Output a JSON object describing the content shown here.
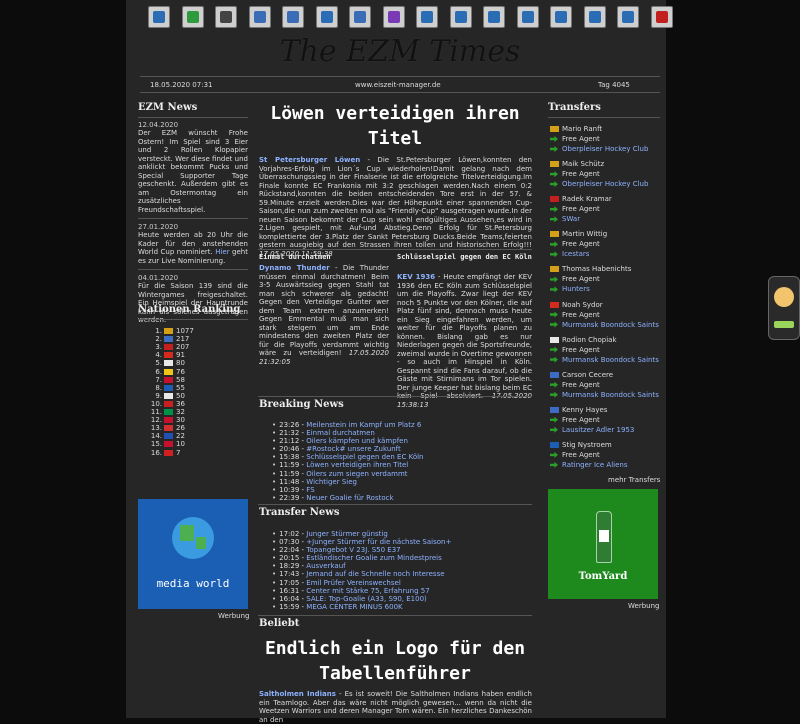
{
  "toolbar": {
    "icons": [
      "home-icon",
      "jersey-icon",
      "lineup-icon",
      "training-icon",
      "list-icon",
      "team-icon",
      "players-icon",
      "calendar-icon",
      "league-icon",
      "tactics-icon",
      "transfers-icon",
      "stats-icon",
      "mail-icon",
      "settings-icon",
      "chat-icon",
      "logout-icon"
    ]
  },
  "masthead": {
    "title": "The EZM Times"
  },
  "dateline": {
    "date": "18.05.2020 07:31",
    "site": "www.eiszeit-manager.de",
    "day": "Tag 4045"
  },
  "ezm_news": {
    "title": "EZM News",
    "items": [
      {
        "date": "12.04.2020",
        "text": "Der EZM wünscht Frohe Ostern! Im Spiel sind 3 Eier und 2 Rollen Klopapier versteckt. Wer diese findet und anklickt bekommt Pucks und Special Supporter Tage geschenkt. Außerdem gibt es am Ostermontag ein zusätzliches Freundschaftsspiel."
      },
      {
        "date": "27.01.2020",
        "text": "Heute werden ab 20 Uhr die Kader für den anstehenden World Cup nominiert.",
        "link": "Hier",
        "text2": " geht es zur Live Nominierung."
      },
      {
        "date": "04.01.2020",
        "text": "Für die Saison 139 sind die Wintergames freigeschaltet. Ein Heimspiel der Hauptrunde kann als solches ausgetragen werden."
      }
    ]
  },
  "rankings": {
    "title": "Nationen Ranking",
    "rows": [
      {
        "rank": "1.",
        "value": "1077",
        "color": "#d4a017"
      },
      {
        "rank": "2.",
        "value": "217",
        "color": "#3c6cc4"
      },
      {
        "rank": "3.",
        "value": "207",
        "color": "#c21f1f"
      },
      {
        "rank": "4.",
        "value": "91",
        "color": "#d52b1e"
      },
      {
        "rank": "5.",
        "value": "80",
        "color": "#e8e8e8"
      },
      {
        "rank": "6.",
        "value": "76",
        "color": "#f0c419"
      },
      {
        "rank": "7.",
        "value": "58",
        "color": "#c8102e"
      },
      {
        "rank": "8.",
        "value": "55",
        "color": "#1b5eb3"
      },
      {
        "rank": "9.",
        "value": "50",
        "color": "#e8e8e8"
      },
      {
        "rank": "10.",
        "value": "36",
        "color": "#c81f1f"
      },
      {
        "rank": "11.",
        "value": "32",
        "color": "#009246"
      },
      {
        "rank": "12.",
        "value": "30",
        "color": "#c8102e"
      },
      {
        "rank": "13.",
        "value": "26",
        "color": "#d03030"
      },
      {
        "rank": "14.",
        "value": "22",
        "color": "#2050b0"
      },
      {
        "rank": "15.",
        "value": "10",
        "color": "#c8102e"
      },
      {
        "rank": "16.",
        "value": "7",
        "color": "#d02020"
      }
    ]
  },
  "ad_left": {
    "text": "media world",
    "label": "Werbung"
  },
  "ad_right": {
    "text": "TomYard",
    "label": "Werbung"
  },
  "lead": {
    "headline": "Löwen verteidigen ihren Titel",
    "link": "St Petersburger Löwen",
    "text": " - Die St.Petersburger Löwen,konnten den Vorjahres-Erfolg im Lion´s Cup wiederholen!Damit gelang nach dem Überraschungssieg in der Finalserie ist die erfolgreiche Titelverteidigung.Im Finale konnte EC Frankonia mit 3:2 geschlagen werden.Nach einem 0:2 Rückstand,konnten die beiden entscheidenden Tore erst in der 57. & 59.Minute erzielt werden.Dies war der Höhepunkt einer spannenden Cup-Saison,die nun zum zweiten mal als \"Friendly-Cup\" ausgetragen wurde.In der neuen Saison bekommt der Cup sein wohl endgültiges Aussehen,es wird in 2.Ligen gespielt, mit Auf-und Abstieg.Denn Erfolg für St.Petersburg komplettierte der 3.Platz der Sankt Petersburg Ducks.Beide Teams,feierten gestern ausgiebig auf den Strassen ihren tollen und historischen Erfolg!!!",
    "stamp": "17.05.2020 11:59:38"
  },
  "story_left": {
    "headline": "Einmal durchatmen",
    "link": "Dynamo Thunder",
    "text": " - Die Thunder müssen einmal durchatmen! Beim 3-5 Auswärtssieg gegen Stahl tat man sich schwerer als gedacht! Gegen den Verteidiger Gunter wer dem Team extrem anzumerken! Gegen Emmental muß man sich stark steigern um am Ende mindestens den zweiten Platz der für die Playoffs verdammt wichtig wäre zu verteidigen!",
    "stamp": "17.05.2020 21:32:05"
  },
  "story_right": {
    "headline": "Schlüsselspiel gegen den EC Köln",
    "link": "KEV 1936",
    "text": " - Heute empfängt der KEV 1936 den EC Köln zum Schlüsselspiel um die Playoffs. Zwar liegt der KEV noch 5 Punkte vor den Kölner, die auf Platz fünf sind, dennoch muss heute ein Sieg eingefahren werden, um weiter für die Playoffs planen zu können. Bislang gab es nur Niederlagen gegen die Sportsfreunde, zweimal wurde in Overtime gewonnen - so auch im Hinspiel in Köln. Gespannt sind die Fans darauf, ob die Gäste mit Stirnimans im Tor spielen. Der junge Keeper hat bislang beim EC kein Spiel absolviert.",
    "stamp": "17.05.2020 15:38:13"
  },
  "breaking": {
    "title": "Breaking News",
    "items": [
      {
        "time": "23:26",
        "text": "Meilenstein im Kampf um Platz 6"
      },
      {
        "time": "21:32",
        "text": "Einmal durchatmen"
      },
      {
        "time": "21:12",
        "text": "Oilers kämpfen und kämpfen"
      },
      {
        "time": "20:46",
        "text": "#Rostock# unsere Zukunft"
      },
      {
        "time": "15:38",
        "text": "Schlüsselspiel gegen den EC Köln"
      },
      {
        "time": "11:59",
        "text": "Löwen verteidigen ihren Titel"
      },
      {
        "time": "11:59",
        "text": "Oilers zum siegen verdammt"
      },
      {
        "time": "11:48",
        "text": "Wichtiger Sieg"
      },
      {
        "time": "10:39",
        "text": "FS"
      },
      {
        "time": "22:39",
        "text": "Neuer Goalie für Rostock"
      }
    ]
  },
  "transfer_news": {
    "title": "Transfer News",
    "items": [
      {
        "time": "17:02",
        "text": "Junger Stürmer günstig"
      },
      {
        "time": "07:30",
        "text": "+Junger Stürmer für die nächste Saison+"
      },
      {
        "time": "22:04",
        "text": "Topangebot V 23J. S50 E37"
      },
      {
        "time": "20:15",
        "text": "Estländischer Goalie zum Mindestpreis"
      },
      {
        "time": "18:29",
        "text": "Ausverkauf"
      },
      {
        "time": "17:43",
        "text": "Jemand auf die Schnelle noch Interesse"
      },
      {
        "time": "17:05",
        "text": "Emil Prüfer Vereinswechsel"
      },
      {
        "time": "16:31",
        "text": "Center mit Stärke 75, Erfahrung 57"
      },
      {
        "time": "16:04",
        "text": "SALE: Top-Goalie (A33, S90, E100)"
      },
      {
        "time": "15:59",
        "text": "MEGA CENTER MINUS 600K"
      }
    ]
  },
  "beliebt": {
    "title": "Beliebt",
    "headline": "Endlich ein Logo für den Tabellenführer",
    "link": "Saltholmen Indians",
    "text": " - Es ist soweit! Die Saltholmen Indians haben endlich ein Teamlogo. Aber das wäre nicht möglich gewesen... wenn da nicht die Weetzen Warriors und deren Manager Tom wären. Ein herzliches Dankeschön an den"
  },
  "transfers": {
    "title": "Transfers",
    "items": [
      {
        "name": "Mario Ranft",
        "agent": "Free Agent",
        "club": "Oberpleiser Hockey Club",
        "flag": "#d4a017"
      },
      {
        "name": "Maik Schütz",
        "agent": "Free Agent",
        "club": "Oberpleiser Hockey Club",
        "flag": "#d4a017"
      },
      {
        "name": "Radek Kramar",
        "agent": "Free Agent",
        "club": "SWar",
        "flag": "#c21f1f"
      },
      {
        "name": "Martin Wittig",
        "agent": "Free Agent",
        "club": "Icestars",
        "flag": "#d4a017"
      },
      {
        "name": "Thomas Habenichts",
        "agent": "Free Agent",
        "club": "Hunters",
        "flag": "#d4a017"
      },
      {
        "name": "Noah Sydor",
        "agent": "Free Agent",
        "club": "Murmansk Boondock Saints",
        "flag": "#d52b1e"
      },
      {
        "name": "Rodion Chopiak",
        "agent": "Free Agent",
        "club": "Murmansk Boondock Saints",
        "flag": "#e8e8e8"
      },
      {
        "name": "Carson Cecere",
        "agent": "Free Agent",
        "club": "Murmansk Boondock Saints",
        "flag": "#3c6cc4"
      },
      {
        "name": "Kenny Hayes",
        "agent": "Free Agent",
        "club": "Lausitzer Adler 1953",
        "flag": "#3c6cc4"
      },
      {
        "name": "Stig Nystroem",
        "agent": "Free Agent",
        "club": "Ratinger Ice Aliens",
        "flag": "#1b5eb3"
      }
    ],
    "more": "mehr Transfers"
  }
}
